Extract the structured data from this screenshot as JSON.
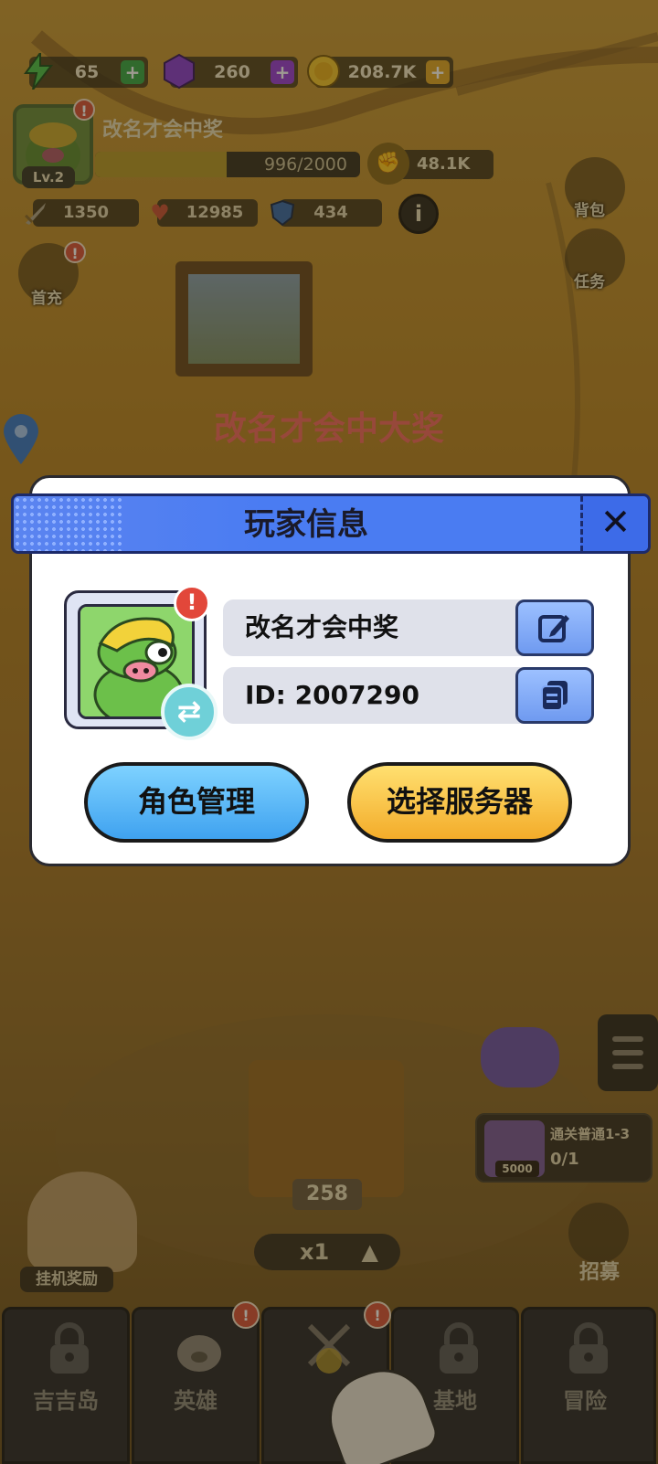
{
  "resources": {
    "energy": {
      "icon": "lightning-icon",
      "value": "65"
    },
    "gems": {
      "icon": "purple-gem-icon",
      "value": "260"
    },
    "coins": {
      "icon": "gold-coin-icon",
      "value": "208.7K"
    }
  },
  "player": {
    "name": "改名才会中奖",
    "level": "Lv.2",
    "xp_text": "996/2000",
    "xp_fraction": 0.498,
    "power": "48.1K",
    "attack": "1350",
    "health": "12985",
    "defense": "434",
    "info_label": "i"
  },
  "side": {
    "bag": "背包",
    "tasks": "任务",
    "first_charge": "首充"
  },
  "tagline": "改名才会中大奖",
  "dialog": {
    "title": "玩家信息",
    "close": "✕",
    "name_value": "改名才会中奖",
    "id_value": "ID: 2007290",
    "alert": "!",
    "swap": "⇄",
    "role_button": "角色管理",
    "server_button": "选择服务器"
  },
  "scene": {
    "crate_count": "258",
    "speed": "x1",
    "quest_title": "通关普通1-3",
    "quest_progress": "0/1",
    "quest_reward": "5000",
    "idle_reward": "挂机奖励",
    "recruit": "招募"
  },
  "nav": [
    {
      "label": "吉吉岛"
    },
    {
      "label": "英雄"
    },
    {
      "label": ""
    },
    {
      "label": "基地"
    },
    {
      "label": "冒险"
    }
  ],
  "colors": {
    "dialog_header": "#4a7cf2",
    "blue_button": "#3fa2f0",
    "gold_button": "#f3ac2a",
    "tagline": "#f36b63"
  }
}
